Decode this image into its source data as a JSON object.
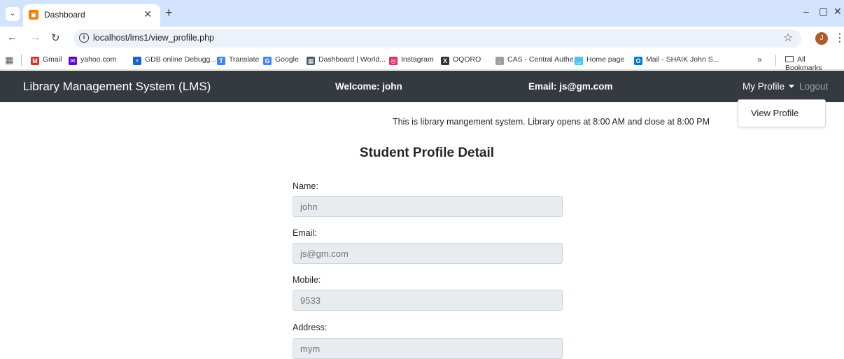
{
  "browser": {
    "tab_title": "Dashboard",
    "url": "localhost/lms1/view_profile.php",
    "avatar_letter": "J",
    "bookmarks": [
      {
        "label": "Gmail",
        "icon": "gmail-icon",
        "color": "#d93025",
        "glyph": "M"
      },
      {
        "label": "yahoo.com",
        "icon": "mail-icon",
        "color": "#6001d2",
        "glyph": "✉"
      },
      {
        "label": "GDB online Debugg...",
        "icon": "gdb-icon",
        "color": "#1565c0",
        "glyph": "⚡"
      },
      {
        "label": "Translate",
        "icon": "translate-icon",
        "color": "#4285f4",
        "glyph": "T"
      },
      {
        "label": "Google",
        "icon": "google-icon",
        "color": "#4285f4",
        "glyph": "G"
      },
      {
        "label": "Dashboard | World...",
        "icon": "dashboard-icon",
        "color": "#455a64",
        "glyph": "▦"
      },
      {
        "label": "Instagram",
        "icon": "instagram-icon",
        "color": "#e1306c",
        "glyph": "◎"
      },
      {
        "label": "OQORO",
        "icon": "oqoro-icon",
        "color": "#333333",
        "glyph": "X"
      },
      {
        "label": "CAS - Central Authe...",
        "icon": "cas-icon",
        "color": "#9e9e9e",
        "glyph": "."
      },
      {
        "label": "Home page",
        "icon": "home-icon",
        "color": "#4fc3f7",
        "glyph": "◡"
      },
      {
        "label": "Mail - SHAIK John S...",
        "icon": "outlook-icon",
        "color": "#0078d4",
        "glyph": "O"
      }
    ],
    "more": "»",
    "all_bookmarks": "All Bookmarks"
  },
  "navbar": {
    "brand": "Library Management System (LMS)",
    "welcome": "Welcome: john",
    "email": "Email: js@gm.com",
    "my_profile": "My Profile",
    "logout": "Logout",
    "dropdown_item": "View Profile"
  },
  "main": {
    "notice": "This is library mangement system. Library opens at 8:00 AM and close at 8:00 PM",
    "title": "Student Profile Detail",
    "fields": [
      {
        "label": "Name:",
        "value": "john"
      },
      {
        "label": "Email:",
        "value": "js@gm.com"
      },
      {
        "label": "Mobile:",
        "value": "9533"
      },
      {
        "label": "Address:",
        "value": "mym"
      }
    ]
  }
}
